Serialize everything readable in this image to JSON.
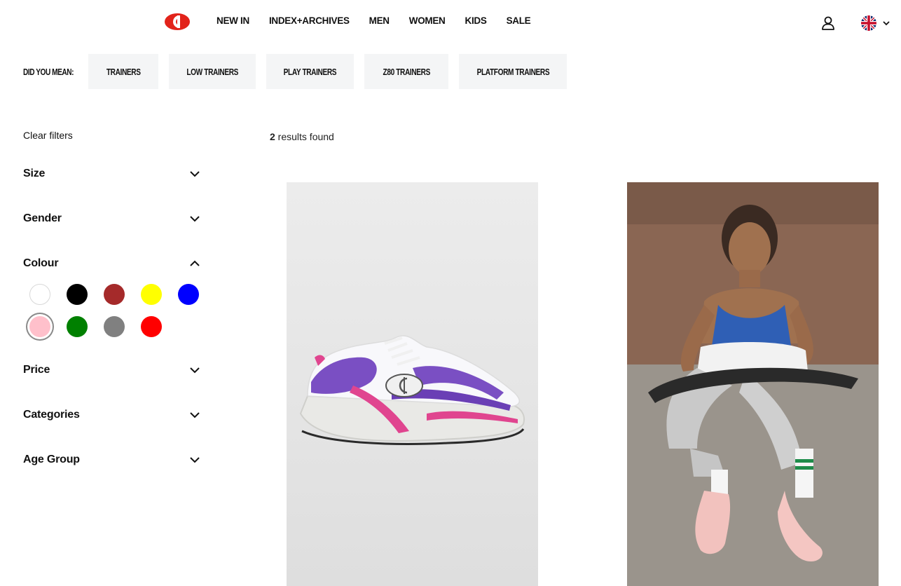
{
  "header": {
    "nav": [
      "NEW IN",
      "INDEX+ARCHIVES",
      "MEN",
      "WOMEN",
      "KIDS",
      "SALE"
    ],
    "logo_icon": "champion-logo-icon",
    "user_icon": "user-account-icon",
    "locale_icon": "uk-flag-icon"
  },
  "did_you_mean": {
    "label": "DID YOU MEAN:",
    "suggestions": [
      "TRAINERS",
      "LOW TRAINERS",
      "PLAY TRAINERS",
      "Z80 TRAINERS",
      "PLATFORM TRAINERS"
    ]
  },
  "filters": {
    "clear_label": "Clear filters",
    "groups": [
      "Size",
      "Gender",
      "Colour",
      "Price",
      "Categories",
      "Age Group"
    ],
    "colour_swatches": [
      {
        "color": "#ffffff",
        "selected": false
      },
      {
        "color": "#000000",
        "selected": false
      },
      {
        "color": "#a52a2a",
        "selected": false
      },
      {
        "color": "#ffff00",
        "selected": false
      },
      {
        "color": "#0000ff",
        "selected": false
      },
      {
        "color": "#ffc0cb",
        "selected": true
      },
      {
        "color": "#008000",
        "selected": false
      },
      {
        "color": "#808080",
        "selected": false
      },
      {
        "color": "#ff0000",
        "selected": false
      }
    ]
  },
  "results": {
    "count": "2",
    "label": " results found"
  },
  "colors": {
    "brand_red": "#e2231a",
    "suggestion_bg": "#f4f5f6"
  }
}
